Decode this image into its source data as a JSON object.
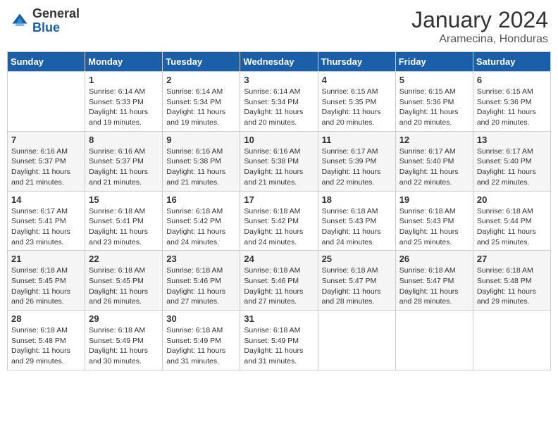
{
  "header": {
    "logo_general": "General",
    "logo_blue": "Blue",
    "month": "January 2024",
    "location": "Aramecina, Honduras"
  },
  "weekdays": [
    "Sunday",
    "Monday",
    "Tuesday",
    "Wednesday",
    "Thursday",
    "Friday",
    "Saturday"
  ],
  "weeks": [
    [
      {
        "day": "",
        "info": ""
      },
      {
        "day": "1",
        "info": "Sunrise: 6:14 AM\nSunset: 5:33 PM\nDaylight: 11 hours\nand 19 minutes."
      },
      {
        "day": "2",
        "info": "Sunrise: 6:14 AM\nSunset: 5:34 PM\nDaylight: 11 hours\nand 19 minutes."
      },
      {
        "day": "3",
        "info": "Sunrise: 6:14 AM\nSunset: 5:34 PM\nDaylight: 11 hours\nand 20 minutes."
      },
      {
        "day": "4",
        "info": "Sunrise: 6:15 AM\nSunset: 5:35 PM\nDaylight: 11 hours\nand 20 minutes."
      },
      {
        "day": "5",
        "info": "Sunrise: 6:15 AM\nSunset: 5:36 PM\nDaylight: 11 hours\nand 20 minutes."
      },
      {
        "day": "6",
        "info": "Sunrise: 6:15 AM\nSunset: 5:36 PM\nDaylight: 11 hours\nand 20 minutes."
      }
    ],
    [
      {
        "day": "7",
        "info": "Sunrise: 6:16 AM\nSunset: 5:37 PM\nDaylight: 11 hours\nand 21 minutes."
      },
      {
        "day": "8",
        "info": "Sunrise: 6:16 AM\nSunset: 5:37 PM\nDaylight: 11 hours\nand 21 minutes."
      },
      {
        "day": "9",
        "info": "Sunrise: 6:16 AM\nSunset: 5:38 PM\nDaylight: 11 hours\nand 21 minutes."
      },
      {
        "day": "10",
        "info": "Sunrise: 6:16 AM\nSunset: 5:38 PM\nDaylight: 11 hours\nand 21 minutes."
      },
      {
        "day": "11",
        "info": "Sunrise: 6:17 AM\nSunset: 5:39 PM\nDaylight: 11 hours\nand 22 minutes."
      },
      {
        "day": "12",
        "info": "Sunrise: 6:17 AM\nSunset: 5:40 PM\nDaylight: 11 hours\nand 22 minutes."
      },
      {
        "day": "13",
        "info": "Sunrise: 6:17 AM\nSunset: 5:40 PM\nDaylight: 11 hours\nand 22 minutes."
      }
    ],
    [
      {
        "day": "14",
        "info": "Sunrise: 6:17 AM\nSunset: 5:41 PM\nDaylight: 11 hours\nand 23 minutes."
      },
      {
        "day": "15",
        "info": "Sunrise: 6:18 AM\nSunset: 5:41 PM\nDaylight: 11 hours\nand 23 minutes."
      },
      {
        "day": "16",
        "info": "Sunrise: 6:18 AM\nSunset: 5:42 PM\nDaylight: 11 hours\nand 24 minutes."
      },
      {
        "day": "17",
        "info": "Sunrise: 6:18 AM\nSunset: 5:42 PM\nDaylight: 11 hours\nand 24 minutes."
      },
      {
        "day": "18",
        "info": "Sunrise: 6:18 AM\nSunset: 5:43 PM\nDaylight: 11 hours\nand 24 minutes."
      },
      {
        "day": "19",
        "info": "Sunrise: 6:18 AM\nSunset: 5:43 PM\nDaylight: 11 hours\nand 25 minutes."
      },
      {
        "day": "20",
        "info": "Sunrise: 6:18 AM\nSunset: 5:44 PM\nDaylight: 11 hours\nand 25 minutes."
      }
    ],
    [
      {
        "day": "21",
        "info": "Sunrise: 6:18 AM\nSunset: 5:45 PM\nDaylight: 11 hours\nand 26 minutes."
      },
      {
        "day": "22",
        "info": "Sunrise: 6:18 AM\nSunset: 5:45 PM\nDaylight: 11 hours\nand 26 minutes."
      },
      {
        "day": "23",
        "info": "Sunrise: 6:18 AM\nSunset: 5:46 PM\nDaylight: 11 hours\nand 27 minutes."
      },
      {
        "day": "24",
        "info": "Sunrise: 6:18 AM\nSunset: 5:46 PM\nDaylight: 11 hours\nand 27 minutes."
      },
      {
        "day": "25",
        "info": "Sunrise: 6:18 AM\nSunset: 5:47 PM\nDaylight: 11 hours\nand 28 minutes."
      },
      {
        "day": "26",
        "info": "Sunrise: 6:18 AM\nSunset: 5:47 PM\nDaylight: 11 hours\nand 28 minutes."
      },
      {
        "day": "27",
        "info": "Sunrise: 6:18 AM\nSunset: 5:48 PM\nDaylight: 11 hours\nand 29 minutes."
      }
    ],
    [
      {
        "day": "28",
        "info": "Sunrise: 6:18 AM\nSunset: 5:48 PM\nDaylight: 11 hours\nand 29 minutes."
      },
      {
        "day": "29",
        "info": "Sunrise: 6:18 AM\nSunset: 5:49 PM\nDaylight: 11 hours\nand 30 minutes."
      },
      {
        "day": "30",
        "info": "Sunrise: 6:18 AM\nSunset: 5:49 PM\nDaylight: 11 hours\nand 31 minutes."
      },
      {
        "day": "31",
        "info": "Sunrise: 6:18 AM\nSunset: 5:49 PM\nDaylight: 11 hours\nand 31 minutes."
      },
      {
        "day": "",
        "info": ""
      },
      {
        "day": "",
        "info": ""
      },
      {
        "day": "",
        "info": ""
      }
    ]
  ]
}
